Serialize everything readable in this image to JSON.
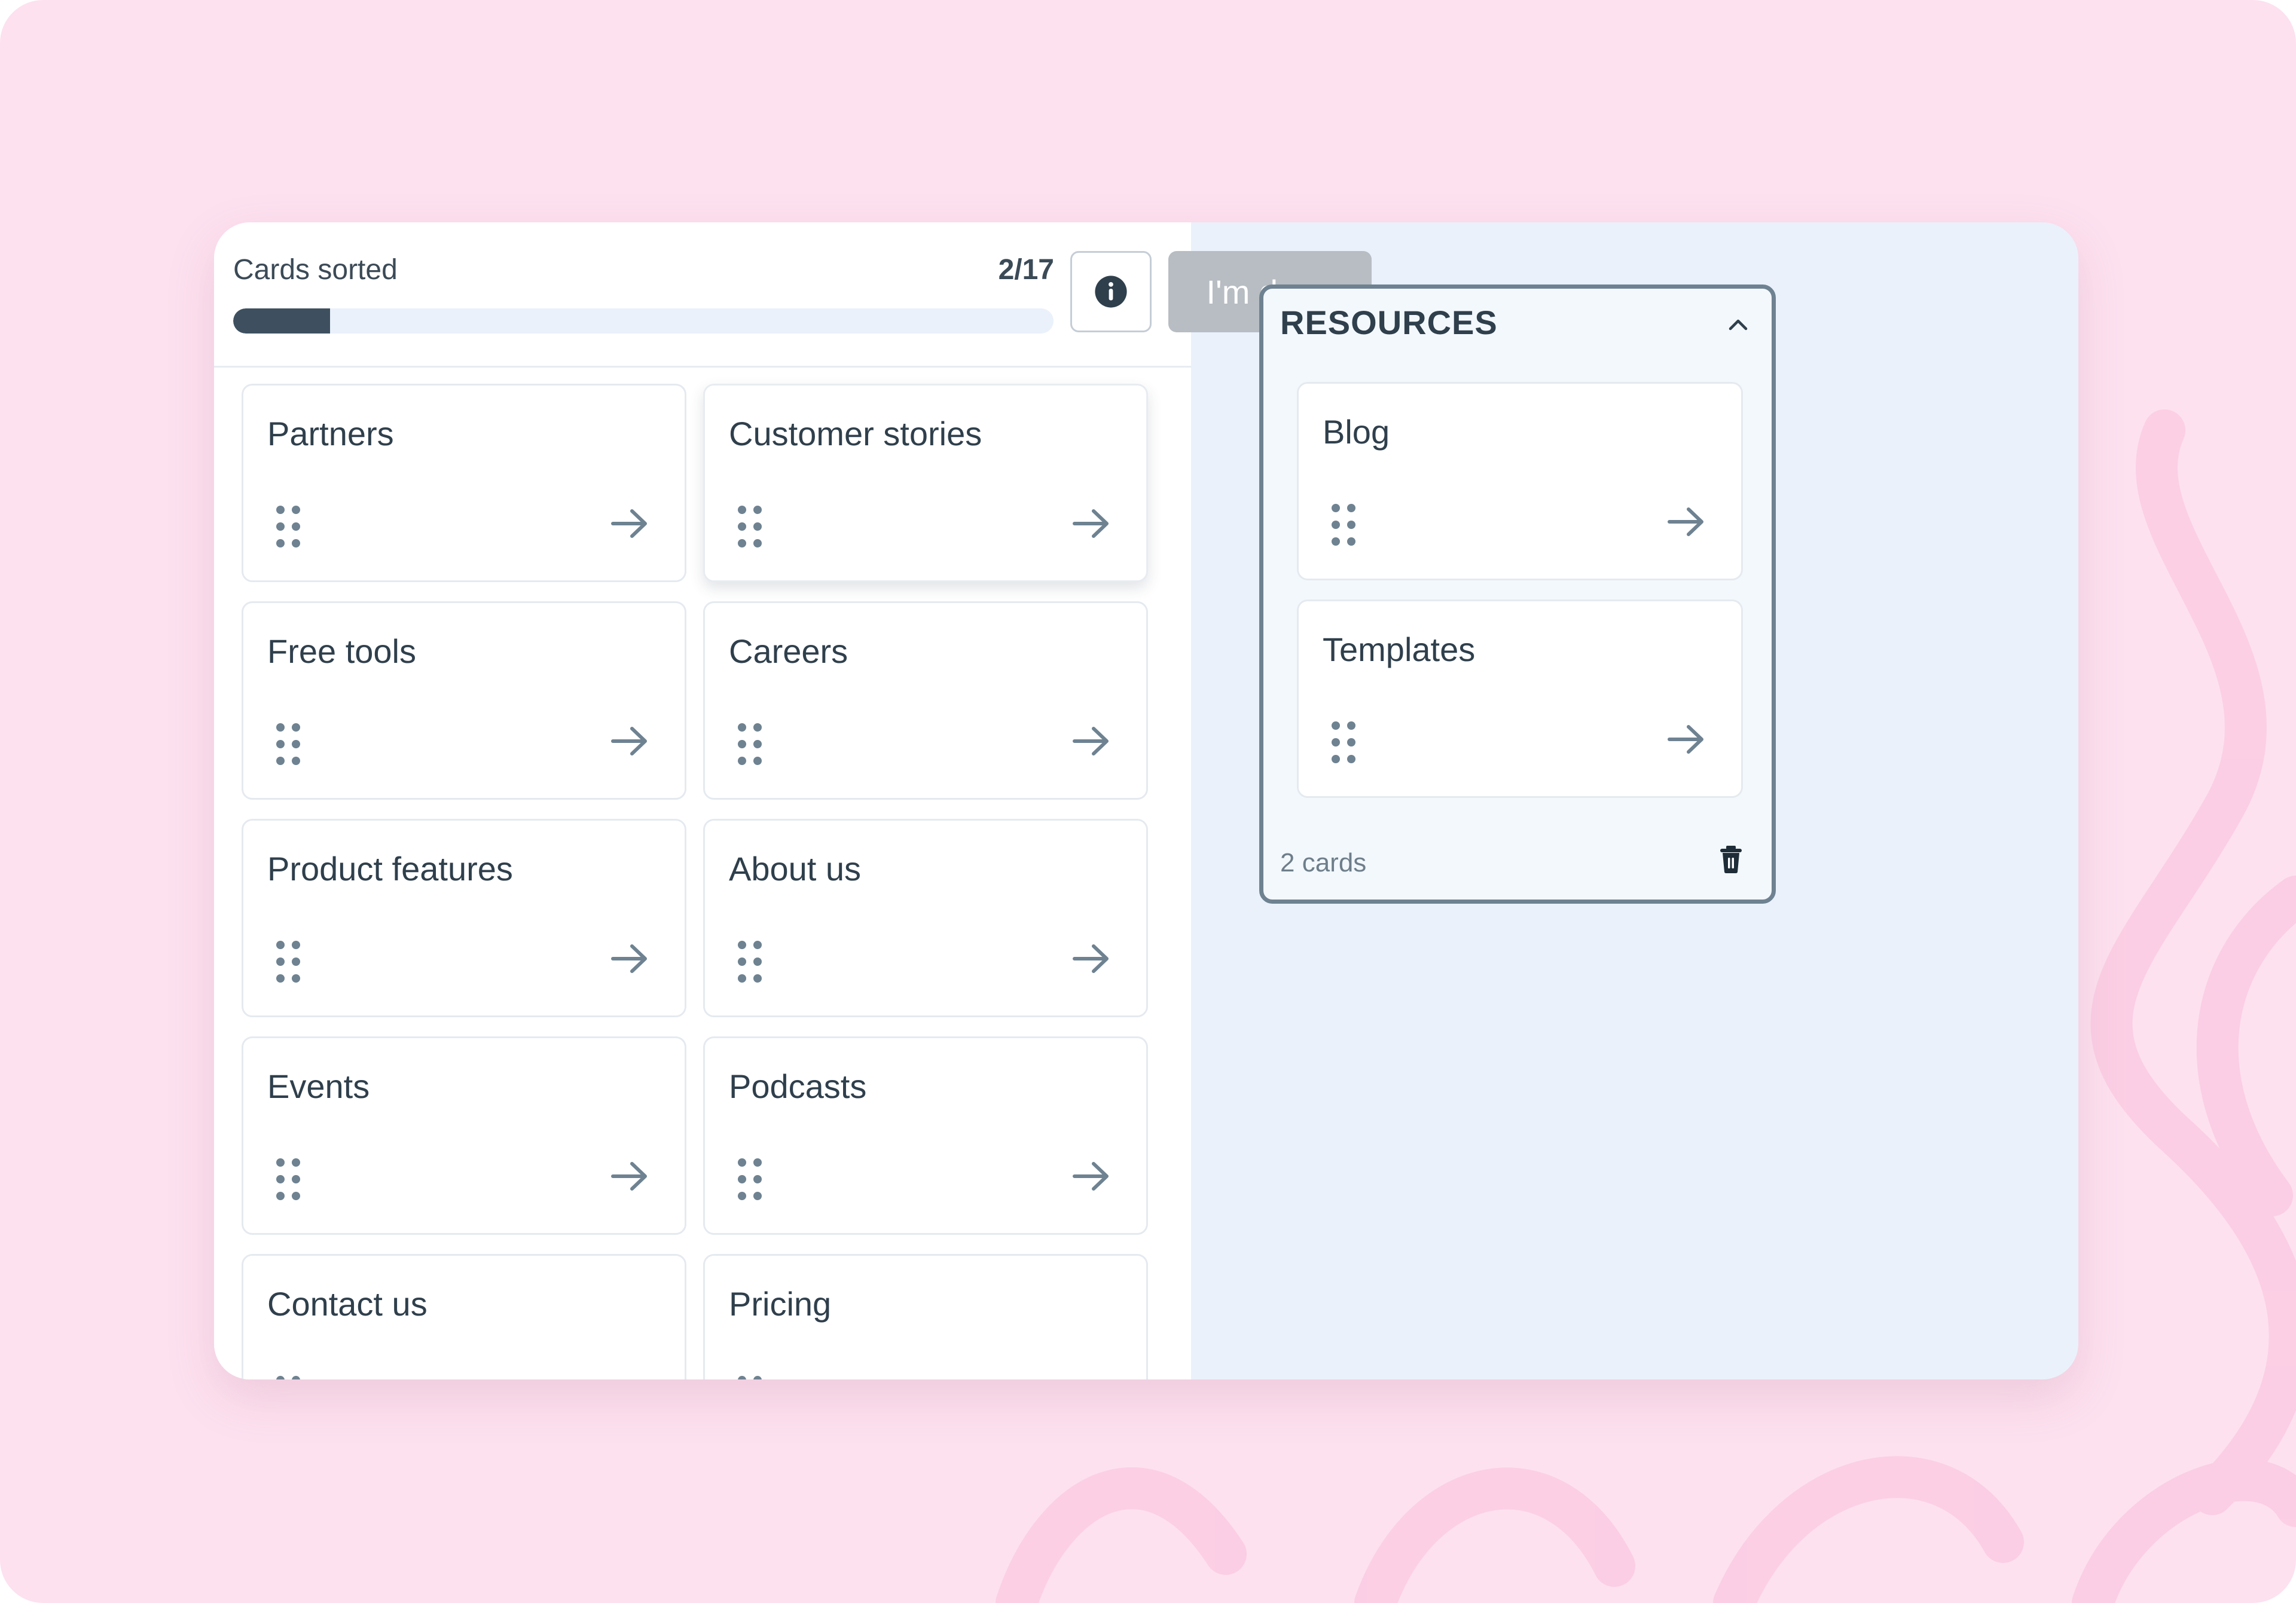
{
  "progress": {
    "label": "Cards sorted",
    "count": "2/17",
    "fraction": 0.118
  },
  "header": {
    "info_icon": "info-icon",
    "done_label": "I'm done"
  },
  "cards": [
    {
      "label": "Partners"
    },
    {
      "label": "Customer stories"
    },
    {
      "label": "Free tools"
    },
    {
      "label": "Careers"
    },
    {
      "label": "Product features"
    },
    {
      "label": "About us"
    },
    {
      "label": "Events"
    },
    {
      "label": "Podcasts"
    },
    {
      "label": "Contact us"
    },
    {
      "label": "Pricing"
    }
  ],
  "group": {
    "title": "RESOURCES",
    "cards": [
      {
        "label": "Blog"
      },
      {
        "label": "Templates"
      }
    ],
    "count_label": "2 cards"
  },
  "colors": {
    "background": "#FDE1EF",
    "accent_dark": "#3E5060",
    "done_disabled": "#B7BDC2",
    "group_border": "#6E8291"
  }
}
